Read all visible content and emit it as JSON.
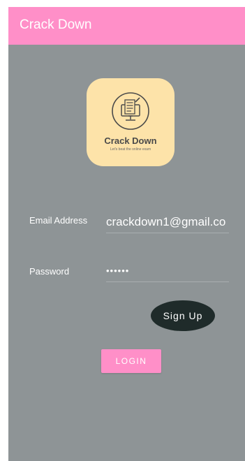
{
  "app_bar": {
    "title": "Crack Down",
    "color": "#ff8fc8"
  },
  "logo": {
    "name": "Crack Down",
    "tagline": "Let's beat the online exam",
    "icon": "computer-checklist-icon",
    "background": "#fde3a9"
  },
  "form": {
    "email": {
      "label": "Email Address",
      "value": "crackdown1@gmail.co"
    },
    "password": {
      "label": "Password",
      "value": "••••••"
    }
  },
  "buttons": {
    "signup_label": "Sign Up",
    "login_label": "LOGIN"
  },
  "colors": {
    "background": "#8e9496",
    "signup_button": "#1f2b2a"
  }
}
